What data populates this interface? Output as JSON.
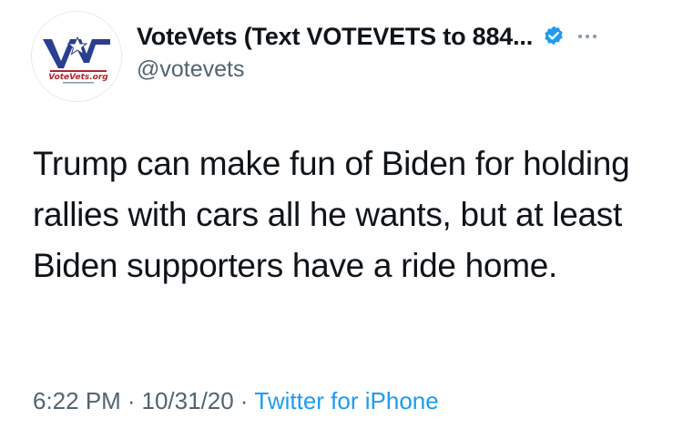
{
  "account": {
    "display_name": "VoteVets (Text VOTEVETS to 884...",
    "handle": "@votevets",
    "avatar": {
      "logo_text": "VoteVets.org",
      "icon": "votevets-logo-icon"
    },
    "verified_icon": "verified-badge-icon",
    "more_icon": "more-options-icon"
  },
  "tweet": {
    "text": "Trump can make fun of Biden for holding rallies with cars all he wants, but at least Biden supporters have a ride home."
  },
  "meta": {
    "time": "6:22 PM",
    "separator": "·",
    "date": "10/31/20",
    "source": "Twitter for iPhone"
  },
  "colors": {
    "text": "#0f1419",
    "secondary": "#536471",
    "link": "#1d9bf0",
    "verified": "#1d9bf0",
    "logo_blue": "#2a3f8f",
    "logo_red": "#b5252c"
  }
}
